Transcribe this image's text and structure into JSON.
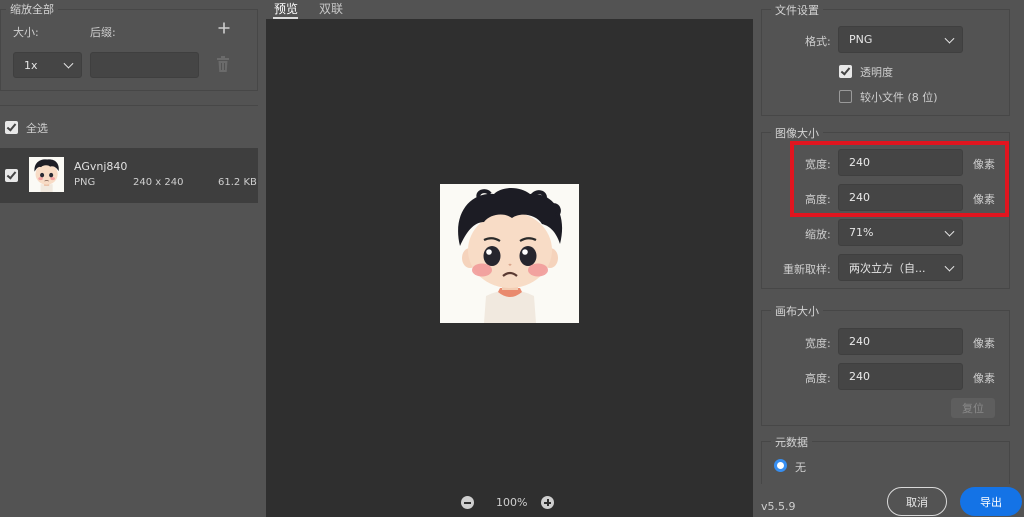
{
  "left": {
    "scale_all_title": "缩放全部",
    "size_label": "大小:",
    "suffix_label": "后缀:",
    "size_value": "1x",
    "suffix_value": "",
    "select_all_label": "全选",
    "assets": [
      {
        "name": "AGvnj840",
        "format": "PNG",
        "dimensions": "240 x 240",
        "filesize": "61.2 KB",
        "checked": true
      }
    ]
  },
  "center": {
    "tabs": [
      {
        "label": "预览",
        "active": true
      },
      {
        "label": "双联",
        "active": false
      }
    ],
    "zoom_level": "100%"
  },
  "right": {
    "file_settings": {
      "title": "文件设置",
      "format_label": "格式:",
      "format_value": "PNG",
      "transparency_label": "透明度",
      "transparency_checked": true,
      "smaller_file_label": "较小文件 (8 位)",
      "smaller_file_checked": false
    },
    "image_size": {
      "title": "图像大小",
      "width_label": "宽度:",
      "width_value": "240",
      "height_label": "高度:",
      "height_value": "240",
      "unit": "像素",
      "scale_label": "缩放:",
      "scale_value": "71%",
      "resample_label": "重新取样:",
      "resample_value": "两次立方（自..."
    },
    "canvas_size": {
      "title": "画布大小",
      "width_label": "宽度:",
      "width_value": "240",
      "height_label": "高度:",
      "height_value": "240",
      "unit": "像素",
      "reset_label": "复位"
    },
    "metadata": {
      "title": "元数据",
      "none_label": "无"
    }
  },
  "footer": {
    "version": "v5.5.9",
    "cancel_label": "取消",
    "export_label": "导出"
  },
  "colors": {
    "panel_bg": "#535353",
    "preview_bg": "#2f2f2f",
    "accent_blue": "#1473e6",
    "highlight_red": "#e0151f"
  }
}
